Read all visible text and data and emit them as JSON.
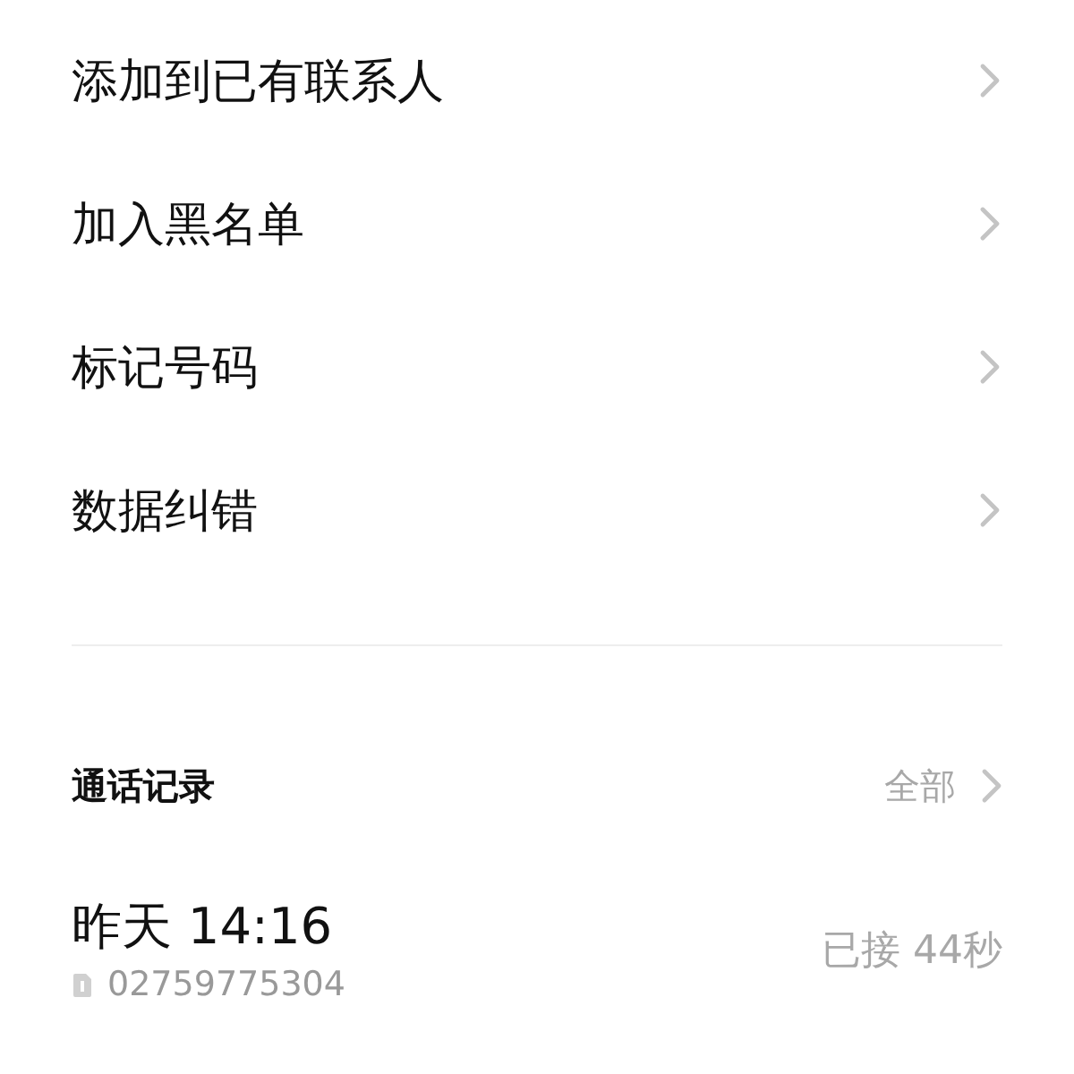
{
  "menu_items": [
    {
      "label": "添加到已有联系人"
    },
    {
      "label": "加入黑名单"
    },
    {
      "label": "标记号码"
    },
    {
      "label": "数据纠错"
    }
  ],
  "call_log": {
    "title": "通话记录",
    "all_link": "全部",
    "entries": [
      {
        "time": "昨天 14:16",
        "number": "02759775304",
        "status": "已接 44秒"
      }
    ]
  }
}
